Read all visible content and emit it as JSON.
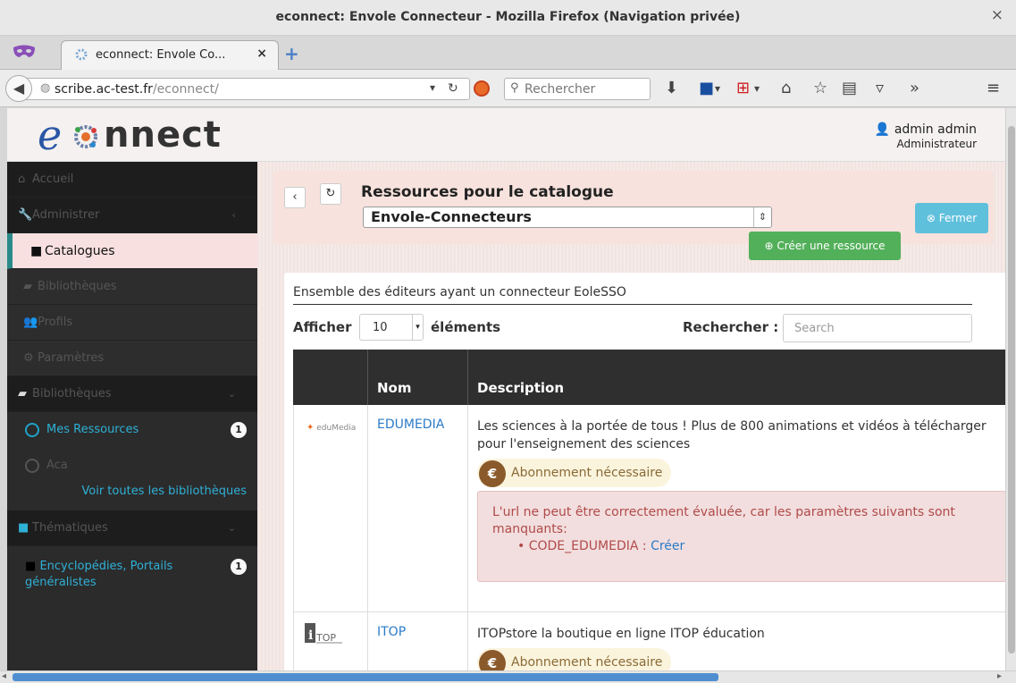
{
  "window": {
    "title": "econnect: Envole Connecteur - Mozilla Firefox (Navigation privée)",
    "close": "×"
  },
  "tab": {
    "label": "econnect: Envole Co...",
    "close": "×",
    "new": "+"
  },
  "nav": {
    "url_host": "scribe.ac-test.fr",
    "url_path": "/econnect/",
    "search_placeholder": "Rechercher"
  },
  "header": {
    "logo_e": "e",
    "logo_rest": "nnect",
    "user_name": "admin admin",
    "user_role": "Administrateur"
  },
  "sidebar": {
    "accueil": "Accueil",
    "administrer": "Administrer",
    "catalogues": "Catalogues",
    "bibliotheques_sub": "Bibliothèques",
    "profils": "Profils",
    "parametres": "Paramètres",
    "bibliotheques": "Bibliothèques",
    "mes_ressources": "Mes Ressources",
    "mes_ressources_count": "1",
    "aca": "Aca",
    "voir_toutes": "Voir toutes les bibliothèques",
    "thematiques": "Thématiques",
    "encyclo": "Encyclopédies, Portails généralistes",
    "encyclo_count": "1"
  },
  "toolbar": {
    "title": "Ressources pour le catalogue",
    "catalogue_selected": "Envole-Connecteurs",
    "fermer": "Fermer",
    "creer": "Créer une ressource"
  },
  "table": {
    "caption": "Ensemble des éditeurs ayant un connecteur EoleSSO",
    "afficher": "Afficher",
    "length": "10",
    "elements": "éléments",
    "rechercher": "Rechercher :",
    "search_placeholder": "Search",
    "columns": [
      "Nom",
      "Description"
    ],
    "rows": [
      {
        "logo": "eduMedia",
        "name": "EDUMEDIA",
        "description": "Les sciences à la portée de tous ! Plus de 800 animations et vidéos à télécharger pour l'enseignement des sciences",
        "subscription": "Abonnement nécessaire",
        "alert": "L'url ne peut être correctement évaluée, car les paramètres suivants sont manquants:",
        "missing_param": "CODE_EDUMEDIA",
        "create_link": "Créer"
      },
      {
        "logo": "iTOP",
        "name": "ITOP",
        "description": "ITOPstore la boutique en ligne ITOP éducation",
        "subscription": "Abonnement nécessaire"
      }
    ]
  },
  "colors": {
    "sidebar": "#2b2b2b",
    "active": "#f9e0e0",
    "fermer": "#5fc0dc",
    "creer": "#53b05a",
    "link": "#2a7bc8"
  }
}
